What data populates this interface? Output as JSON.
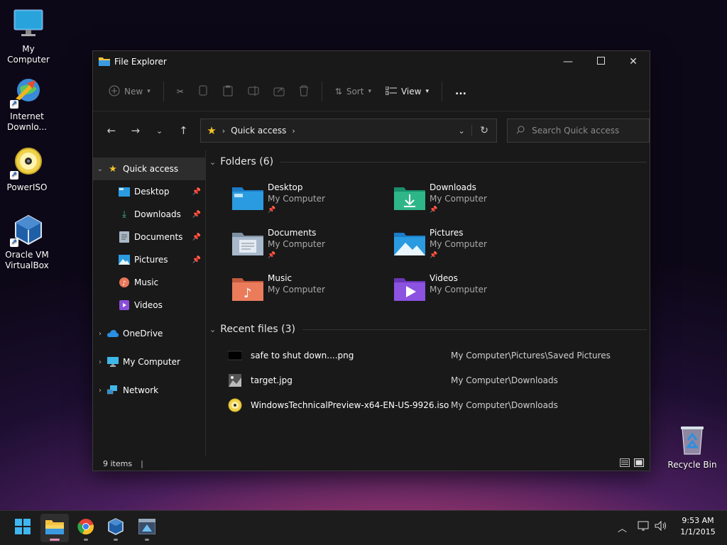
{
  "desktop": {
    "icons": [
      {
        "label": "My Computer"
      },
      {
        "label": "Internet Downlo..."
      },
      {
        "label": "PowerISO"
      },
      {
        "label": "Oracle VM VirtualBox"
      },
      {
        "label": "Recycle Bin"
      }
    ]
  },
  "window": {
    "title": "File Explorer",
    "toolbar": {
      "new_label": "New",
      "sort_label": "Sort",
      "view_label": "View",
      "more_label": "..."
    },
    "address": {
      "location": "Quick access"
    },
    "search": {
      "placeholder": "Search Quick access"
    },
    "nav": {
      "quick_access": "Quick access",
      "items": [
        {
          "label": "Desktop"
        },
        {
          "label": "Downloads"
        },
        {
          "label": "Documents"
        },
        {
          "label": "Pictures"
        },
        {
          "label": "Music"
        },
        {
          "label": "Videos"
        }
      ],
      "onedrive": "OneDrive",
      "my_computer": "My Computer",
      "network": "Network"
    },
    "folders_header": "Folders (6)",
    "folders": [
      {
        "name": "Desktop",
        "location": "My Computer"
      },
      {
        "name": "Downloads",
        "location": "My Computer"
      },
      {
        "name": "Documents",
        "location": "My Computer"
      },
      {
        "name": "Pictures",
        "location": "My Computer"
      },
      {
        "name": "Music",
        "location": "My Computer"
      },
      {
        "name": "Videos",
        "location": "My Computer"
      }
    ],
    "recent_header": "Recent files (3)",
    "recent": [
      {
        "name": "safe to shut down....png",
        "path": "My Computer\\Pictures\\Saved Pictures"
      },
      {
        "name": "target.jpg",
        "path": "My Computer\\Downloads"
      },
      {
        "name": "WindowsTechnicalPreview-x64-EN-US-9926.iso",
        "path": "My Computer\\Downloads"
      }
    ],
    "status": {
      "items": "9 items"
    }
  },
  "taskbar": {
    "time": "9:53 AM",
    "date": "1/1/2015"
  },
  "colors": {
    "accent": "#4cc2ff",
    "taskbar_active": "#e58fb7"
  }
}
